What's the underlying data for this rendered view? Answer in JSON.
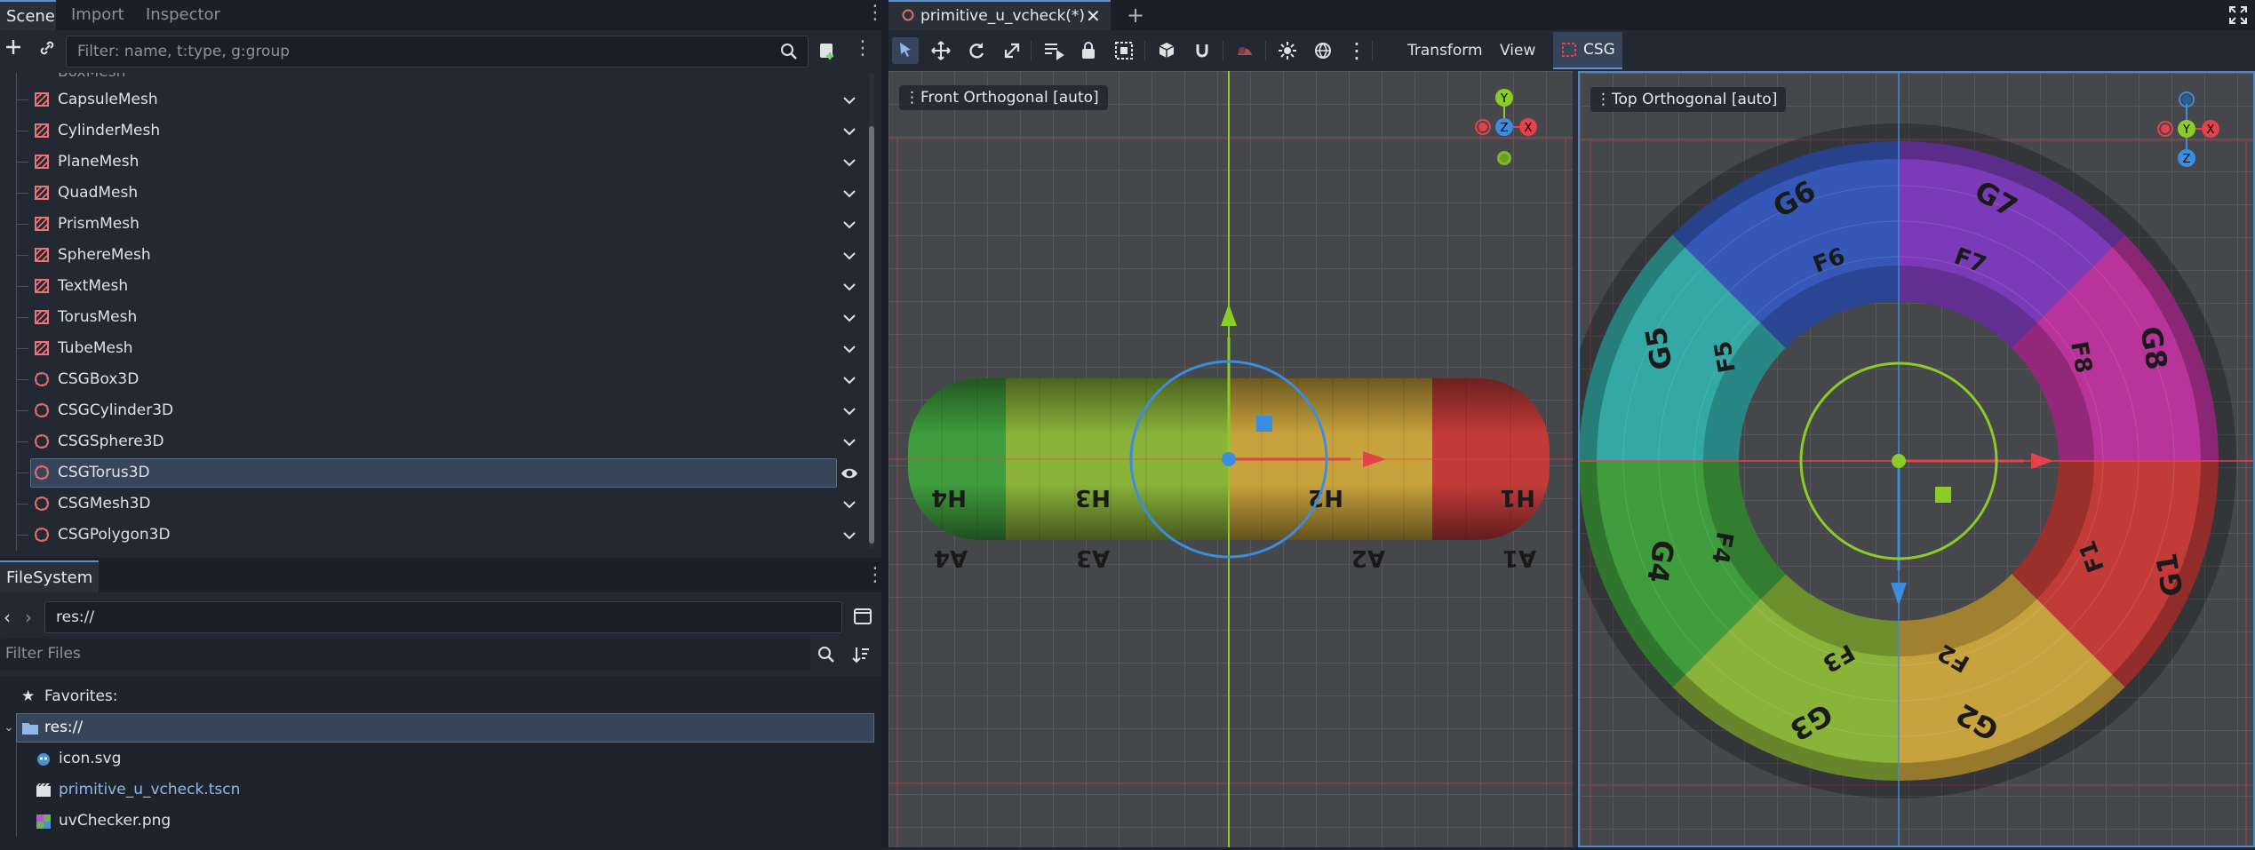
{
  "dock_tabs": [
    "Scene",
    "Import",
    "Inspector"
  ],
  "scene_filter": {
    "placeholder": "Filter: name, t:type, g:group"
  },
  "scene_nodes": [
    {
      "label": "CapsuleMesh",
      "icon": "mesh-icon"
    },
    {
      "label": "CylinderMesh",
      "icon": "mesh-icon"
    },
    {
      "label": "PlaneMesh",
      "icon": "mesh-icon"
    },
    {
      "label": "QuadMesh",
      "icon": "mesh-icon"
    },
    {
      "label": "PrismMesh",
      "icon": "mesh-icon"
    },
    {
      "label": "SphereMesh",
      "icon": "mesh-icon"
    },
    {
      "label": "TextMesh",
      "icon": "mesh-icon"
    },
    {
      "label": "TorusMesh",
      "icon": "mesh-icon"
    },
    {
      "label": "TubeMesh",
      "icon": "mesh-icon"
    },
    {
      "label": "CSGBox3D",
      "icon": "csg-icon"
    },
    {
      "label": "CSGCylinder3D",
      "icon": "csg-icon"
    },
    {
      "label": "CSGSphere3D",
      "icon": "csg-icon"
    },
    {
      "label": "CSGTorus3D",
      "icon": "csg-icon",
      "selected": true
    },
    {
      "label": "CSGMesh3D",
      "icon": "csg-icon"
    },
    {
      "label": "CSGPolygon3D",
      "icon": "csg-icon"
    }
  ],
  "filesystem": {
    "tab": "FileSystem",
    "path": "res://",
    "filter_placeholder": "Filter Files",
    "favorites_label": "Favorites:",
    "root_label": "res://",
    "files": [
      {
        "label": "icon.svg",
        "icon": "svg-file-icon",
        "color": "#dfe1e5"
      },
      {
        "label": "primitive_u_vcheck.tscn",
        "icon": "scene-file-icon",
        "color": "#8fb8e8"
      },
      {
        "label": "uvChecker.png",
        "icon": "image-file-icon",
        "color": "#dfe1e5"
      }
    ]
  },
  "editor_tab": {
    "label": "primitive_u_vcheck(*)"
  },
  "toolbar": {
    "transform_label": "Transform",
    "view_label": "View",
    "csg_label": "CSG"
  },
  "viewports": {
    "left": {
      "label": "Front Orthogonal [auto]"
    },
    "right": {
      "label": "Top Orthogonal [auto]"
    }
  },
  "gizmo_axes": {
    "x": "X",
    "y": "Y",
    "z": "Z"
  },
  "colors": {
    "x_axis": "#e5414a",
    "y_axis": "#8ccc26",
    "z_axis": "#3b8de0",
    "accent": "#5a8fd6"
  },
  "uv_labels": {
    "front_top": [
      "H4",
      "H3",
      "H2",
      "H1"
    ],
    "front_bottom": [
      "A4",
      "A3",
      "A2",
      "A1"
    ],
    "top_outer": [
      "G1",
      "G3",
      "G2",
      "G4",
      "G5",
      "G6",
      "G7",
      "G8"
    ],
    "top_inner": [
      "F1",
      "F2",
      "F3",
      "F4",
      "F5",
      "F6",
      "F7",
      "F8"
    ]
  }
}
